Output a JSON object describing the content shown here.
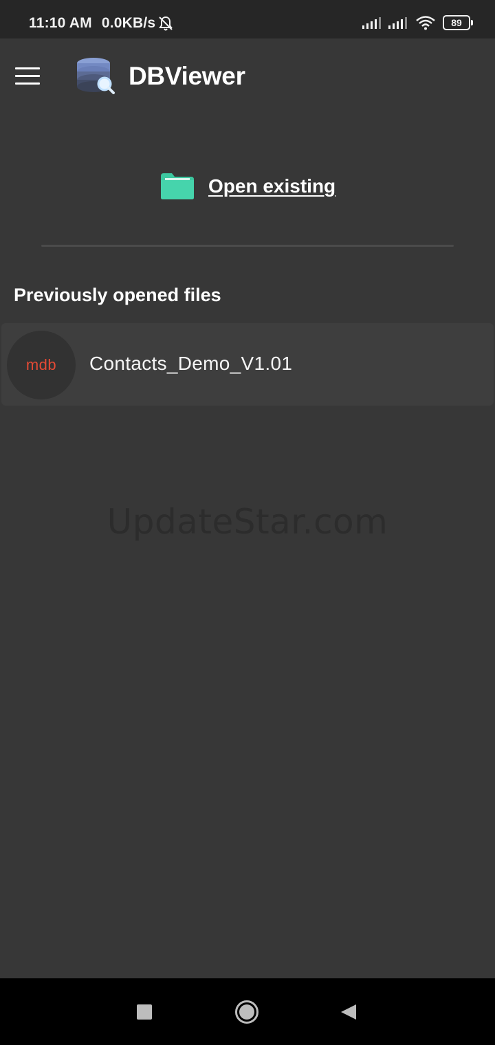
{
  "status_bar": {
    "time": "11:10 AM",
    "network_speed": "0.0KB/s",
    "battery_level": "89",
    "icons": [
      "bell-muted-icon",
      "signal-icon",
      "signal-icon",
      "wifi-icon",
      "battery-icon"
    ]
  },
  "app_bar": {
    "title": "DBViewer",
    "icons": [
      "menu-icon",
      "database-search-icon"
    ]
  },
  "actions": {
    "open_existing_label": "Open existing",
    "icon": "folder-icon"
  },
  "recent_files": {
    "section_title": "Previously opened files",
    "items": [
      {
        "extension": "mdb",
        "name": "Contacts_Demo_V1.01"
      }
    ]
  },
  "watermark": "UpdateStar.com",
  "nav_bar": {
    "icons": [
      "recents-square-icon",
      "home-circle-icon",
      "back-triangle-icon"
    ]
  },
  "colors": {
    "background": "#373737",
    "status_bar": "#262626",
    "folder_accent": "#3cc8a0",
    "file_extension": "#e54a35",
    "list_item": "#3e3e3e"
  }
}
